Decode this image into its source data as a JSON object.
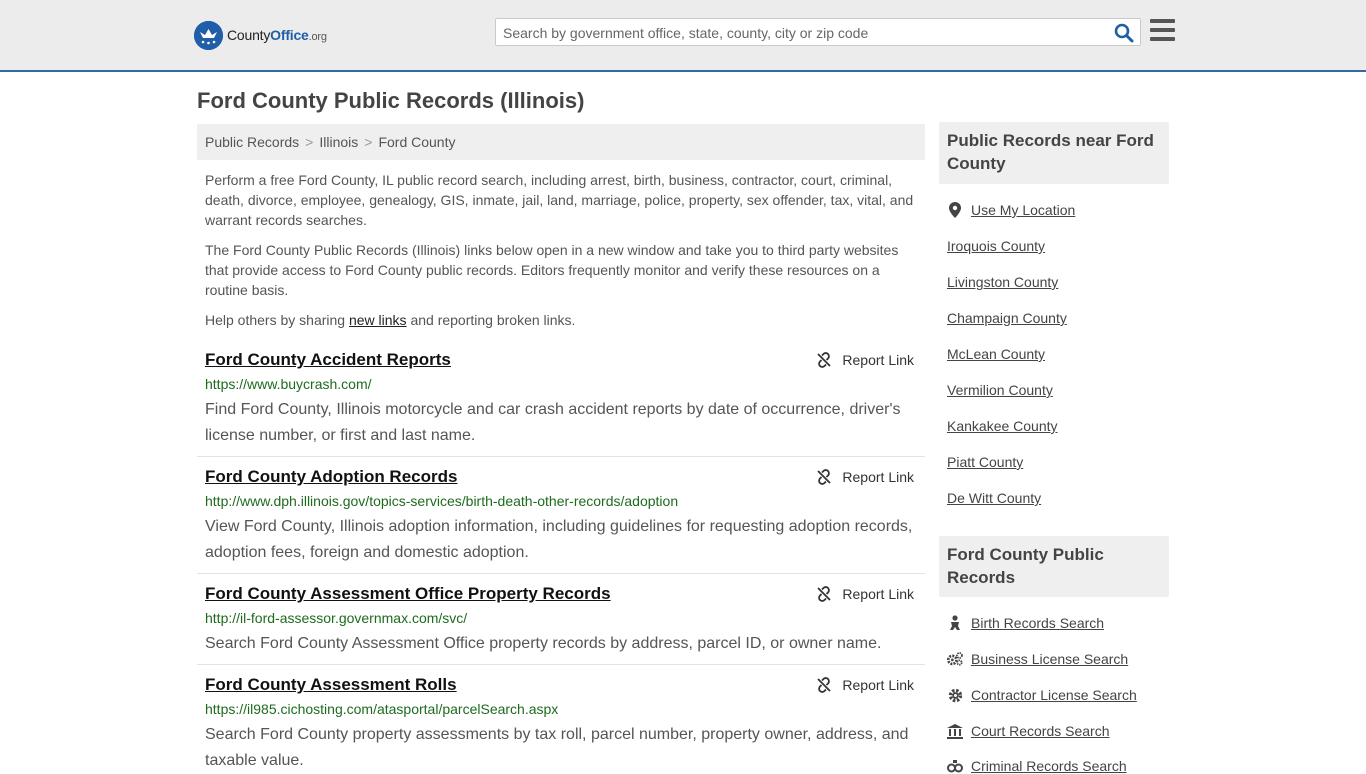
{
  "brand": {
    "name_prefix": "County",
    "name_bold": "Office",
    "name_suffix": ".org"
  },
  "search": {
    "placeholder": "Search by government office, state, county, city or zip code"
  },
  "page_title": "Ford County Public Records (Illinois)",
  "breadcrumb": [
    "Public Records",
    "Illinois",
    "Ford County"
  ],
  "intro": {
    "p1": "Perform a free Ford County, IL public record search, including arrest, birth, business, contractor, court, criminal, death, divorce, employee, genealogy, GIS, inmate, jail, land, marriage, police, property, sex offender, tax, vital, and warrant records searches.",
    "p2": "The Ford County Public Records (Illinois) links below open in a new window and take you to third party websites that provide access to Ford County public records. Editors frequently monitor and verify these resources on a routine basis.",
    "p3_before": "Help others by sharing ",
    "p3_link": "new links",
    "p3_after": " and reporting broken links."
  },
  "report_label": "Report Link",
  "records": [
    {
      "title": "Ford County Accident Reports",
      "url": "https://www.buycrash.com/",
      "desc": "Find Ford County, Illinois motorcycle and car crash accident reports by date of occurrence, driver's license number, or first and last name."
    },
    {
      "title": "Ford County Adoption Records",
      "url": "http://www.dph.illinois.gov/topics-services/birth-death-other-records/adoption",
      "desc": "View Ford County, Illinois adoption information, including guidelines for requesting adoption records, adoption fees, foreign and domestic adoption."
    },
    {
      "title": "Ford County Assessment Office Property Records",
      "url": "http://il-ford-assessor.governmax.com/svc/",
      "desc": "Search Ford County Assessment Office property records by address, parcel ID, or owner name."
    },
    {
      "title": "Ford County Assessment Rolls",
      "url": "https://il985.cichosting.com/atasportal/parcelSearch.aspx",
      "desc": "Search Ford County property assessments by tax roll, parcel number, property owner, address, and taxable value."
    }
  ],
  "sidebar": {
    "near_title": "Public Records near Ford County",
    "use_location": "Use My Location",
    "nearby": [
      "Iroquois County",
      "Livingston County",
      "Champaign County",
      "McLean County",
      "Vermilion County",
      "Kankakee County",
      "Piatt County",
      "De Witt County"
    ],
    "records_title": "Ford County Public Records",
    "record_links": [
      {
        "label": "Birth Records Search",
        "icon": "baby-icon"
      },
      {
        "label": "Business License Search",
        "icon": "gears-icon"
      },
      {
        "label": "Contractor License Search",
        "icon": "gear-icon"
      },
      {
        "label": "Court Records Search",
        "icon": "courthouse-icon"
      },
      {
        "label": "Criminal Records Search",
        "icon": "handcuffs-icon"
      }
    ]
  },
  "colors": {
    "accent": "#1f5ea8",
    "url_green": "#1e6b1e",
    "panel": "#efefef"
  }
}
